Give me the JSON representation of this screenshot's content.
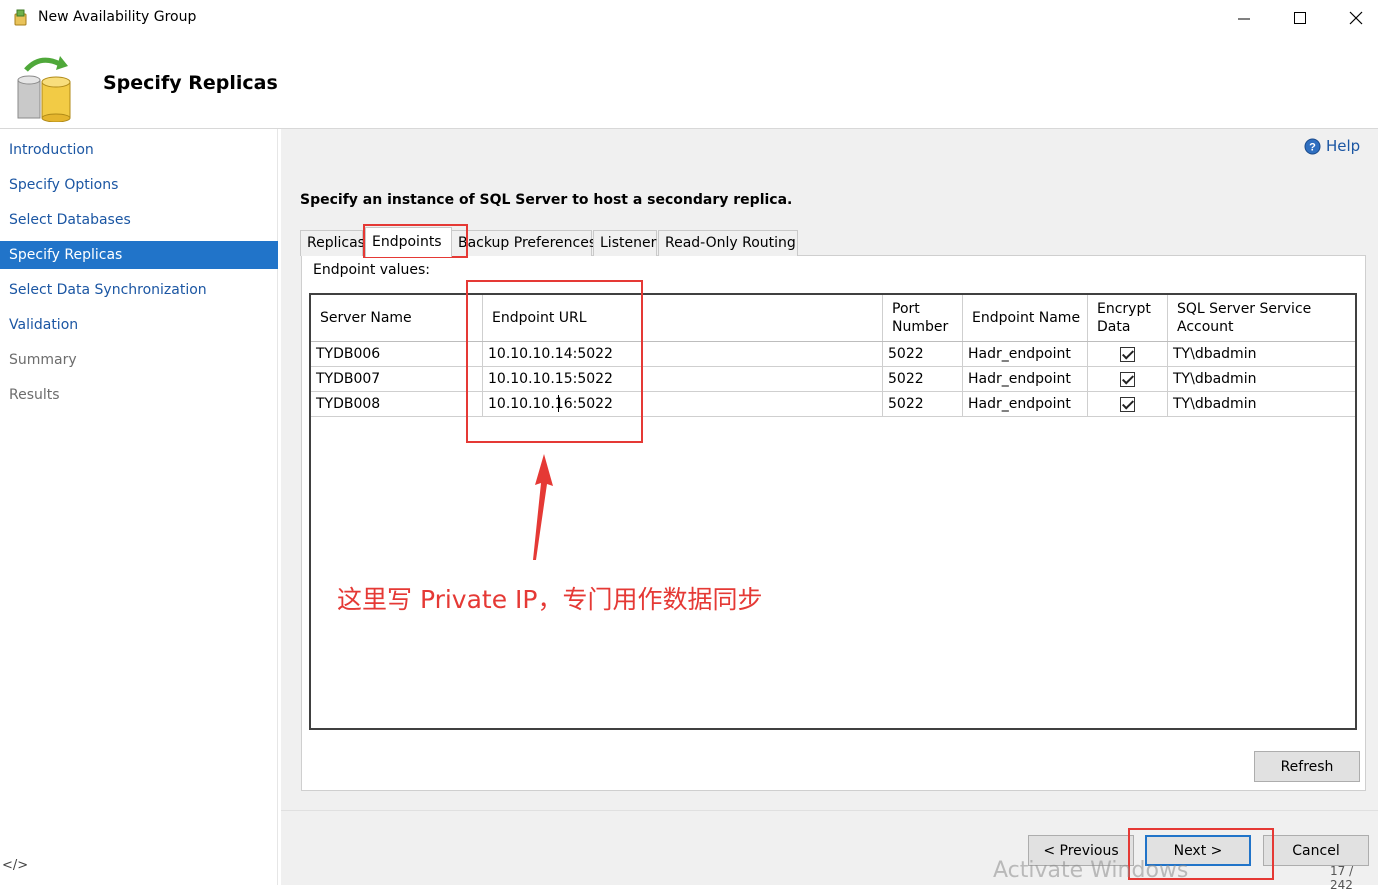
{
  "window": {
    "title": "New Availability Group"
  },
  "header": {
    "title": "Specify Replicas"
  },
  "nav": {
    "items": [
      {
        "label": "Introduction"
      },
      {
        "label": "Specify Options"
      },
      {
        "label": "Select Databases"
      },
      {
        "label": "Specify Replicas"
      },
      {
        "label": "Select Data Synchronization"
      },
      {
        "label": "Validation"
      },
      {
        "label": "Summary"
      },
      {
        "label": "Results"
      }
    ],
    "footer": "</>"
  },
  "help": {
    "label": "Help",
    "icon": "help-icon"
  },
  "main": {
    "instruction": "Specify an instance of SQL Server to host a secondary replica.",
    "tabs": [
      {
        "label": "Replicas"
      },
      {
        "label": "Endpoints"
      },
      {
        "label": "Backup Preferences"
      },
      {
        "label": "Listener"
      },
      {
        "label": "Read-Only Routing"
      }
    ],
    "endpoint_values_label": "Endpoint values:",
    "grid": {
      "columns": [
        "Server Name",
        "Endpoint URL",
        "Port Number",
        "Endpoint Name",
        "Encrypt Data",
        "SQL Server Service Account"
      ],
      "rows": [
        {
          "server": "TYDB006",
          "url": "10.10.10.14:5022",
          "port": "5022",
          "endpoint": "Hadr_endpoint",
          "encrypt": true,
          "account": "TY\\dbadmin"
        },
        {
          "server": "TYDB007",
          "url": "10.10.10.15:5022",
          "port": "5022",
          "endpoint": "Hadr_endpoint",
          "encrypt": true,
          "account": "TY\\dbadmin"
        },
        {
          "server": "TYDB008",
          "url": "10.10.10.16:5022",
          "port": "5022",
          "endpoint": "Hadr_endpoint",
          "encrypt": true,
          "account": "TY\\dbadmin"
        }
      ]
    },
    "annotation": "这里写 Private IP，专门用作数据同步",
    "refresh_label": "Refresh"
  },
  "footer": {
    "previous_label": "< Previous",
    "next_label": "Next >",
    "cancel_label": "Cancel",
    "watermark": "Activate Windows",
    "page_counter": "17 / 242"
  },
  "colors": {
    "selection": "#2174c9",
    "annotation": "#e53935",
    "link": "#1b56a3"
  }
}
